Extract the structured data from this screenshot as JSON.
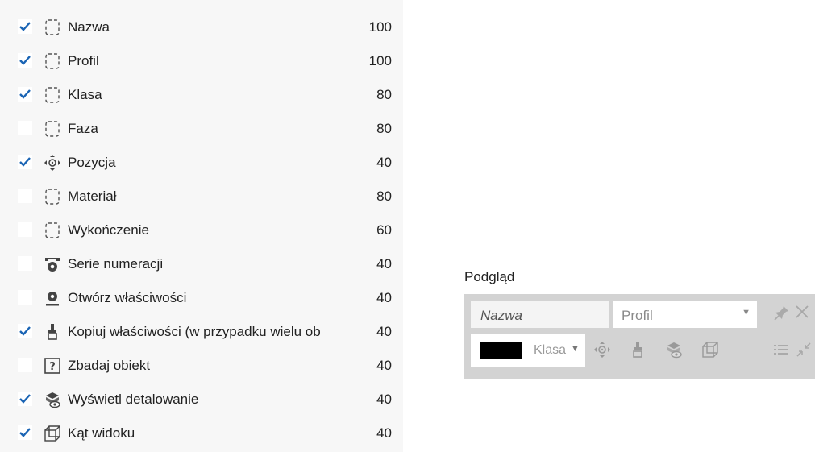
{
  "rows": [
    {
      "label": "Nazwa",
      "value": "100",
      "checked": true,
      "icon": "dashed-frame-icon"
    },
    {
      "label": "Profil",
      "value": "100",
      "checked": true,
      "icon": "dashed-frame-icon"
    },
    {
      "label": "Klasa",
      "value": "80",
      "checked": true,
      "icon": "dashed-frame-icon"
    },
    {
      "label": "Faza",
      "value": "80",
      "checked": false,
      "icon": "dashed-frame-icon"
    },
    {
      "label": "Pozycja",
      "value": "40",
      "checked": true,
      "icon": "position-icon"
    },
    {
      "label": "Materiał",
      "value": "80",
      "checked": false,
      "icon": "dashed-frame-icon"
    },
    {
      "label": "Wykończenie",
      "value": "60",
      "checked": false,
      "icon": "dashed-frame-icon"
    },
    {
      "label": "Serie numeracji",
      "value": "40",
      "checked": false,
      "icon": "numbering-series-icon"
    },
    {
      "label": "Otwórz właściwości",
      "value": "40",
      "checked": false,
      "icon": "properties-icon"
    },
    {
      "label": "Kopiuj właściwości (w przypadku wielu ob",
      "value": "40",
      "checked": true,
      "icon": "copy-properties-icon"
    },
    {
      "label": "Zbadaj obiekt",
      "value": "40",
      "checked": false,
      "icon": "inquire-object-icon"
    },
    {
      "label": "Wyświetl detalowanie",
      "value": "40",
      "checked": true,
      "icon": "show-detailing-icon"
    },
    {
      "label": "Kąt widoku",
      "value": "40",
      "checked": true,
      "icon": "view-angle-icon"
    }
  ],
  "preview": {
    "title": "Podgląd",
    "name_field": "Nazwa",
    "profile_field": "Profil",
    "class_label": "Klasa",
    "color_value": "#000000"
  },
  "colors": {
    "check": "#1a64b4",
    "icon": "#444444",
    "panel": "#d3d3d3",
    "accent_muted": "#9a9a9a"
  }
}
